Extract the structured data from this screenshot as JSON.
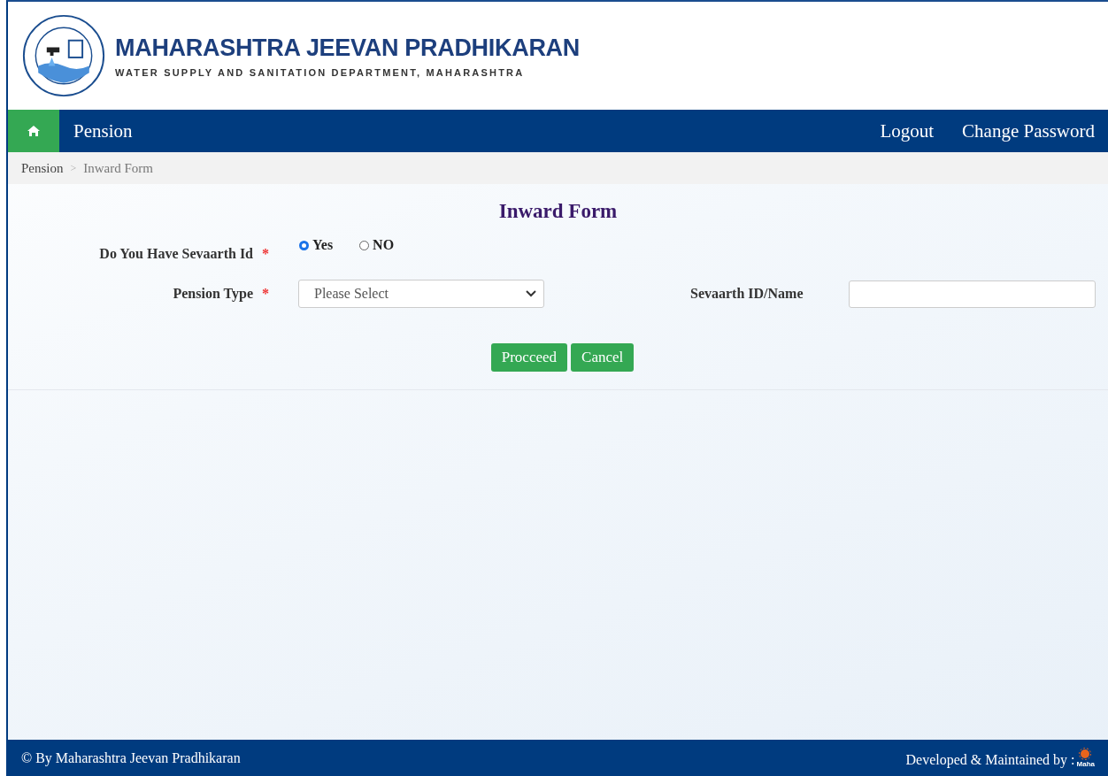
{
  "header": {
    "title": "MAHARASHTRA JEEVAN PRADHIKARAN",
    "subtitle": "WATER SUPPLY AND SANITATION DEPARTMENT, MAHARASHTRA"
  },
  "nav": {
    "brand": "Pension",
    "links": [
      "Logout",
      "Change Password"
    ]
  },
  "breadcrumb": {
    "items": [
      "Pension",
      "Inward Form"
    ],
    "separator": ">"
  },
  "form": {
    "title": "Inward Form",
    "sevaarth_question": {
      "label": "Do You Have Sevaarth Id",
      "required_mark": "*",
      "options": [
        {
          "label": "Yes",
          "selected": true
        },
        {
          "label": "NO",
          "selected": false
        }
      ]
    },
    "pension_type": {
      "label": "Pension Type",
      "required_mark": "*",
      "placeholder": "Please Select"
    },
    "sevaarth_id": {
      "label": "Sevaarth ID/Name"
    },
    "buttons": [
      "Procceed",
      "Cancel"
    ]
  },
  "footer": {
    "copyright": "© By Maharashtra Jeevan Pradhikaran",
    "credit": "Developed & Maintained by :",
    "logo_text": "Maha"
  }
}
